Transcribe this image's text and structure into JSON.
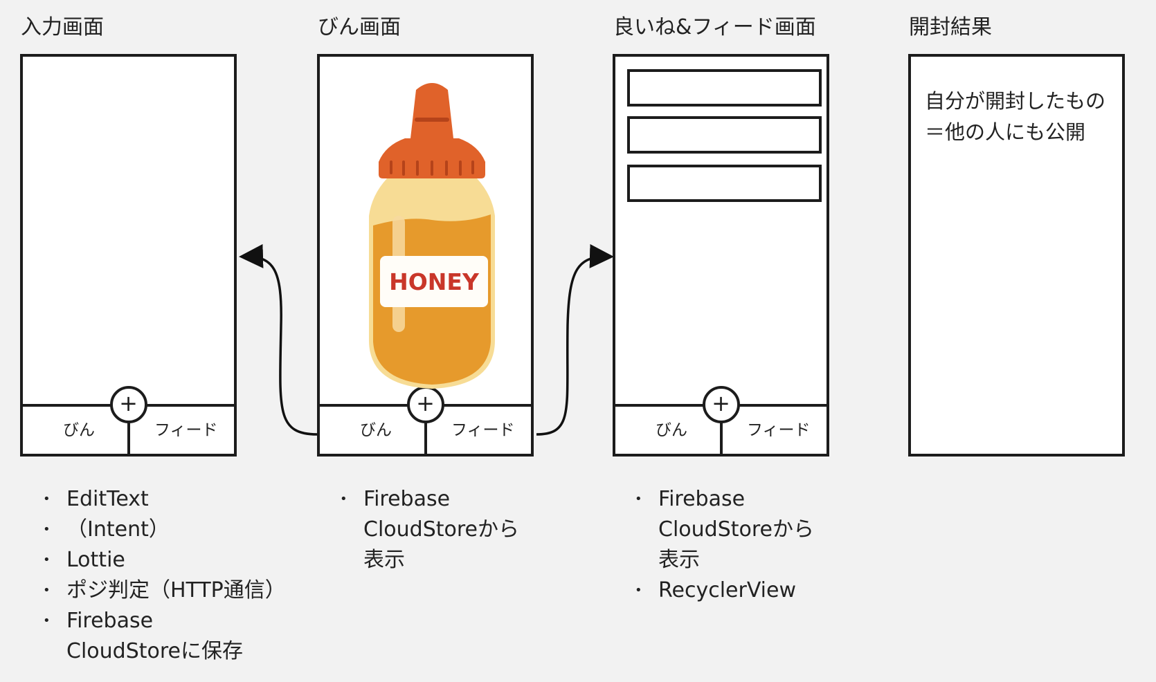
{
  "screens": [
    {
      "title": "入力画面",
      "nav_left": "びん",
      "nav_right": "フィード",
      "plus": "+"
    },
    {
      "title": "びん画面",
      "nav_left": "びん",
      "nav_right": "フィード",
      "plus": "+",
      "label": "HONEY"
    },
    {
      "title": "良いね&フィード画面",
      "nav_left": "びん",
      "nav_right": "フィード",
      "plus": "+"
    },
    {
      "title": "開封結果",
      "note_line1": "自分が開封したもの",
      "note_line2": "＝他の人にも公開"
    }
  ],
  "notes": [
    [
      "EditText",
      "（Intent）",
      "Lottie",
      "ポジ判定（HTTP通信）",
      "Firebase\nCloudStoreに保存"
    ],
    [
      "Firebase\nCloudStoreから\n表示"
    ],
    [
      "Firebase\nCloudStoreから\n表示",
      "RecyclerView"
    ]
  ],
  "colors": {
    "background": "#f2f2f2",
    "outline": "#1c1c1c",
    "cap": "#e0622a",
    "honey": "#e69a2c",
    "label_text": "#c9372a"
  }
}
